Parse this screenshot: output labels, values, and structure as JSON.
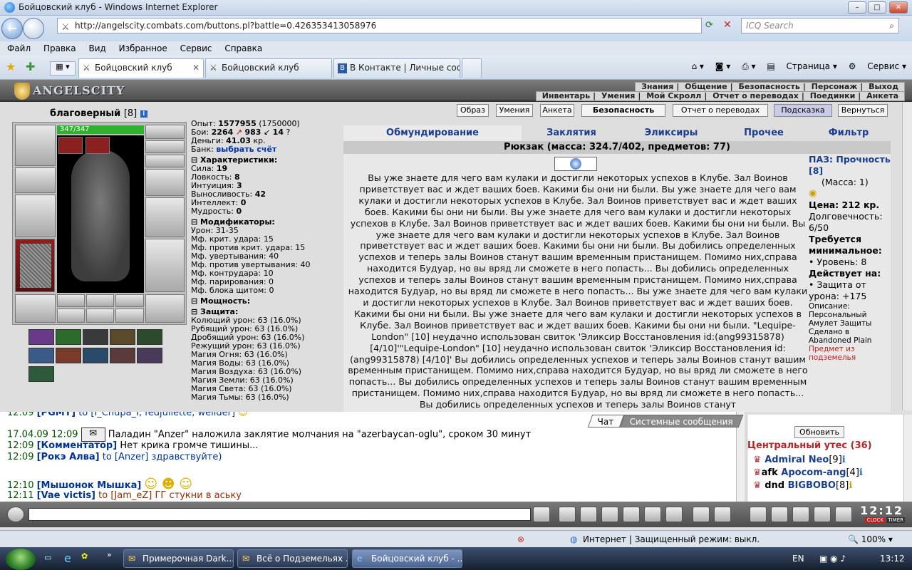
{
  "window": {
    "title": "Бойцовский клуб - Windows Internet Explorer"
  },
  "address": {
    "url": "http://angelscity.combats.com/buttons.pl?battle=0.426353413058976",
    "search_placeholder": "ICQ Search"
  },
  "menu": [
    "Файл",
    "Правка",
    "Вид",
    "Избранное",
    "Сервис",
    "Справка"
  ],
  "tabs": [
    {
      "label": "Бойцовский клуб"
    },
    {
      "label": "Бойцовский клуб"
    },
    {
      "label": "В Контакте | Личные соо..."
    }
  ],
  "commandbar": {
    "page": "Страница",
    "tools": "Сервис"
  },
  "game": {
    "logo": "ANGELSCITY",
    "menu_top": [
      "Знания",
      "Общение",
      "Безопасность",
      "Персонаж",
      "Выход"
    ],
    "menu_bottom": [
      "Инвентарь",
      "Умения",
      "Мой Скролл",
      "Отчет о переводах",
      "Поединки",
      "Анкета"
    ]
  },
  "character": {
    "name": "благоверный",
    "level": "[8]",
    "hp": "347/347",
    "exp_label": "Опыт:",
    "exp": "1577955",
    "exp_next": "(1750000)",
    "fights_label": "Бои:",
    "wins": "2264",
    "losses": "983",
    "draws": "14",
    "money_label": "Деньги:",
    "money": "41.03",
    "money_unit": "кр.",
    "bank_label": "Банк:",
    "bank_link": "выбрать счёт"
  },
  "stats": {
    "char_title": "Характеристики:",
    "chars": [
      "Сила: ",
      "Ловкость: ",
      "Интуиция: ",
      "Выносливость: ",
      "Интеллект: ",
      "Мудрость: "
    ],
    "char_vals": [
      "19",
      "8",
      "3",
      "42",
      "0",
      "0"
    ],
    "mod_title": "Модификаторы:",
    "mods": [
      "Урон: 31-35",
      "Мф. крит. удара: 15",
      "Мф. против крит. удара: 15",
      "Мф. увертывания: 40",
      "Мф. против увертывания: 40",
      "Мф. контрудара: 10",
      "Мф. парирования: 0",
      "Мф. блока щитом: 0"
    ],
    "power_title": "Мощность:",
    "def_title": "Защита:",
    "defs": [
      "Колющий урон: 63 (16.0%)",
      "Рубящий урон: 63 (16.0%)",
      "Дробящий урон: 63 (16.0%)",
      "Режущий урон: 63 (16.0%)",
      "Магия Огня: 63 (16.0%)",
      "Магия Воды: 63 (16.0%)",
      "Магия Воздуха: 63 (16.0%)",
      "Магия Земли: 63 (16.0%)",
      "Магия Света: 63 (16.0%)",
      "Магия Тьмы: 63 (16.0%)"
    ]
  },
  "buttons": [
    "Образ",
    "Умения",
    "Анкета",
    "Безопасность",
    "Отчет о переводах",
    "Подсказка",
    "Вернуться"
  ],
  "inv_tabs": [
    "Обмундирование",
    "Заклятия",
    "Эликсиры",
    "Прочее",
    "Фильтр"
  ],
  "backpack": "Рюкзак (масса: 324.7/402, предметов: 77)",
  "description": "Вы уже знаете для чего вам кулаки и достигли некоторых успехов в Клубе. Зал Воинов приветствует вас и ждет ваших боев. Какими бы они ни были. Вы уже знаете для чего вам кулаки и достигли некоторых успехов в Клубе. Зал Воинов приветствует вас и ждет ваших боев. Какими бы они ни были. Вы уже знаете для чего вам кулаки и достигли некоторых успехов в Клубе. Зал Воинов приветствует вас и ждет ваших боев. Какими бы они ни были. Вы уже знаете для чего вам кулаки и достигли некоторых успехов в Клубе. Зал Воинов приветствует вас и ждет ваших боев. Какими бы они ни были. Вы добились определенных успехов и теперь залы Воинов станут вашим временным пристанищем. Помимо них,справа находится Будуар, но вы вряд ли сможете в него попасть... Вы добились определенных успехов и теперь залы Воинов станут вашим временным пристанищем. Помимо них,справа находится Будуар, но вы вряд ли сможете в него попасть... Вы уже знаете для чего вам кулаки и достигли некоторых успехов в Клубе. Зал Воинов приветствует вас и ждет ваших боев. Какими бы они ни были. Вы уже знаете для чего вам кулаки и достигли некоторых успехов в Клубе. Зал Воинов приветствует вас и ждет ваших боев. Какими бы они ни были. \"Lequipe-London\" [10] неудачно использован свиток 'Эликсир Восстановления id:(ang99315878) [4/10]'\"Lequipe-London\" [10] неудачно использован свиток 'Эликсир Восстановления id:(ang99315878) [4/10]' Вы добились определенных успехов и теперь залы Воинов станут вашим временным пристанищем. Помимо них,справа находится Будуар, но вы вряд ли сможете в него попасть... Вы добились определенных успехов и теперь залы Воинов станут вашим временным пристанищем. Помимо них,справа находится Будуар, но вы вряд ли сможете в него попасть... Вы добились определенных успехов и теперь залы Воинов станут",
  "item": {
    "name": "ПАЗ: Прочность [8]",
    "mass": "(Масса: 1)",
    "price": "Цена: 212 кр.",
    "durability": "Долговечность: 6/50",
    "req_title": "Требуется минимальное:",
    "req": "• Уровень: 8",
    "acts_title": "Действует на:",
    "acts": "• Защита от урона: +175",
    "desc": "Описание: Персональный Амулет Защиты Сделано в Abandoned Plain",
    "origin": "Предмет из подземелья"
  },
  "chat": {
    "tab_chat": "Чат",
    "tab_sys": "Системные сообщения",
    "lines": [
      {
        "time": "12:09",
        "name": "[PGMY]",
        "to": "to [I_Chupa_I, fedjuliette, welider]",
        "text": ""
      },
      {
        "time": "17.04.09 12:09",
        "name": "",
        "to": "",
        "text": "Паладин \"Anzer\" наложила заклятие молчания на \"azerbaycan-oglu\", сроком 30 минут"
      },
      {
        "time": "12:09",
        "name": "[Комментатор]",
        "to": "",
        "text": "Нет крика громче тишины..."
      },
      {
        "time": "12:09",
        "name": "[Рокэ Алва]",
        "to": "to [Anzer] здравствуйте)",
        "text": ""
      },
      {
        "time": "12:10",
        "name": "[Мышонок Мышка]",
        "to": "",
        "text": ""
      },
      {
        "time": "12:11",
        "name": "[Vae victis]",
        "to": "to [Jam_eZ] ГГ стукни в аську",
        "text": ""
      }
    ]
  },
  "online": {
    "refresh": "Обновить",
    "location": "Центральный утес (36)",
    "users": [
      {
        "prefix": "",
        "name": "Admiral Neo",
        "lvl": "[9]"
      },
      {
        "prefix": "afk ",
        "name": "Apocom-ang",
        "lvl": "[4]"
      },
      {
        "prefix": "dnd ",
        "name": "BIGBOBO",
        "lvl": "[8]"
      }
    ]
  },
  "clock": "12:12",
  "clock_labels": [
    "CLOCK",
    "TIMER"
  ],
  "status": {
    "zone": "Интернет | Защищенный режим: выкл.",
    "zoom": "100%"
  },
  "taskbar": {
    "tasks": [
      "Примерочная Dark...",
      "Всё о Подземельях ...",
      "Бойцовский клуб - ..."
    ],
    "lang": "EN",
    "time": "13:12"
  },
  "colors": {
    "link": "#1a3d8f",
    "hp": "#2fb32f",
    "error": "#c02020"
  }
}
